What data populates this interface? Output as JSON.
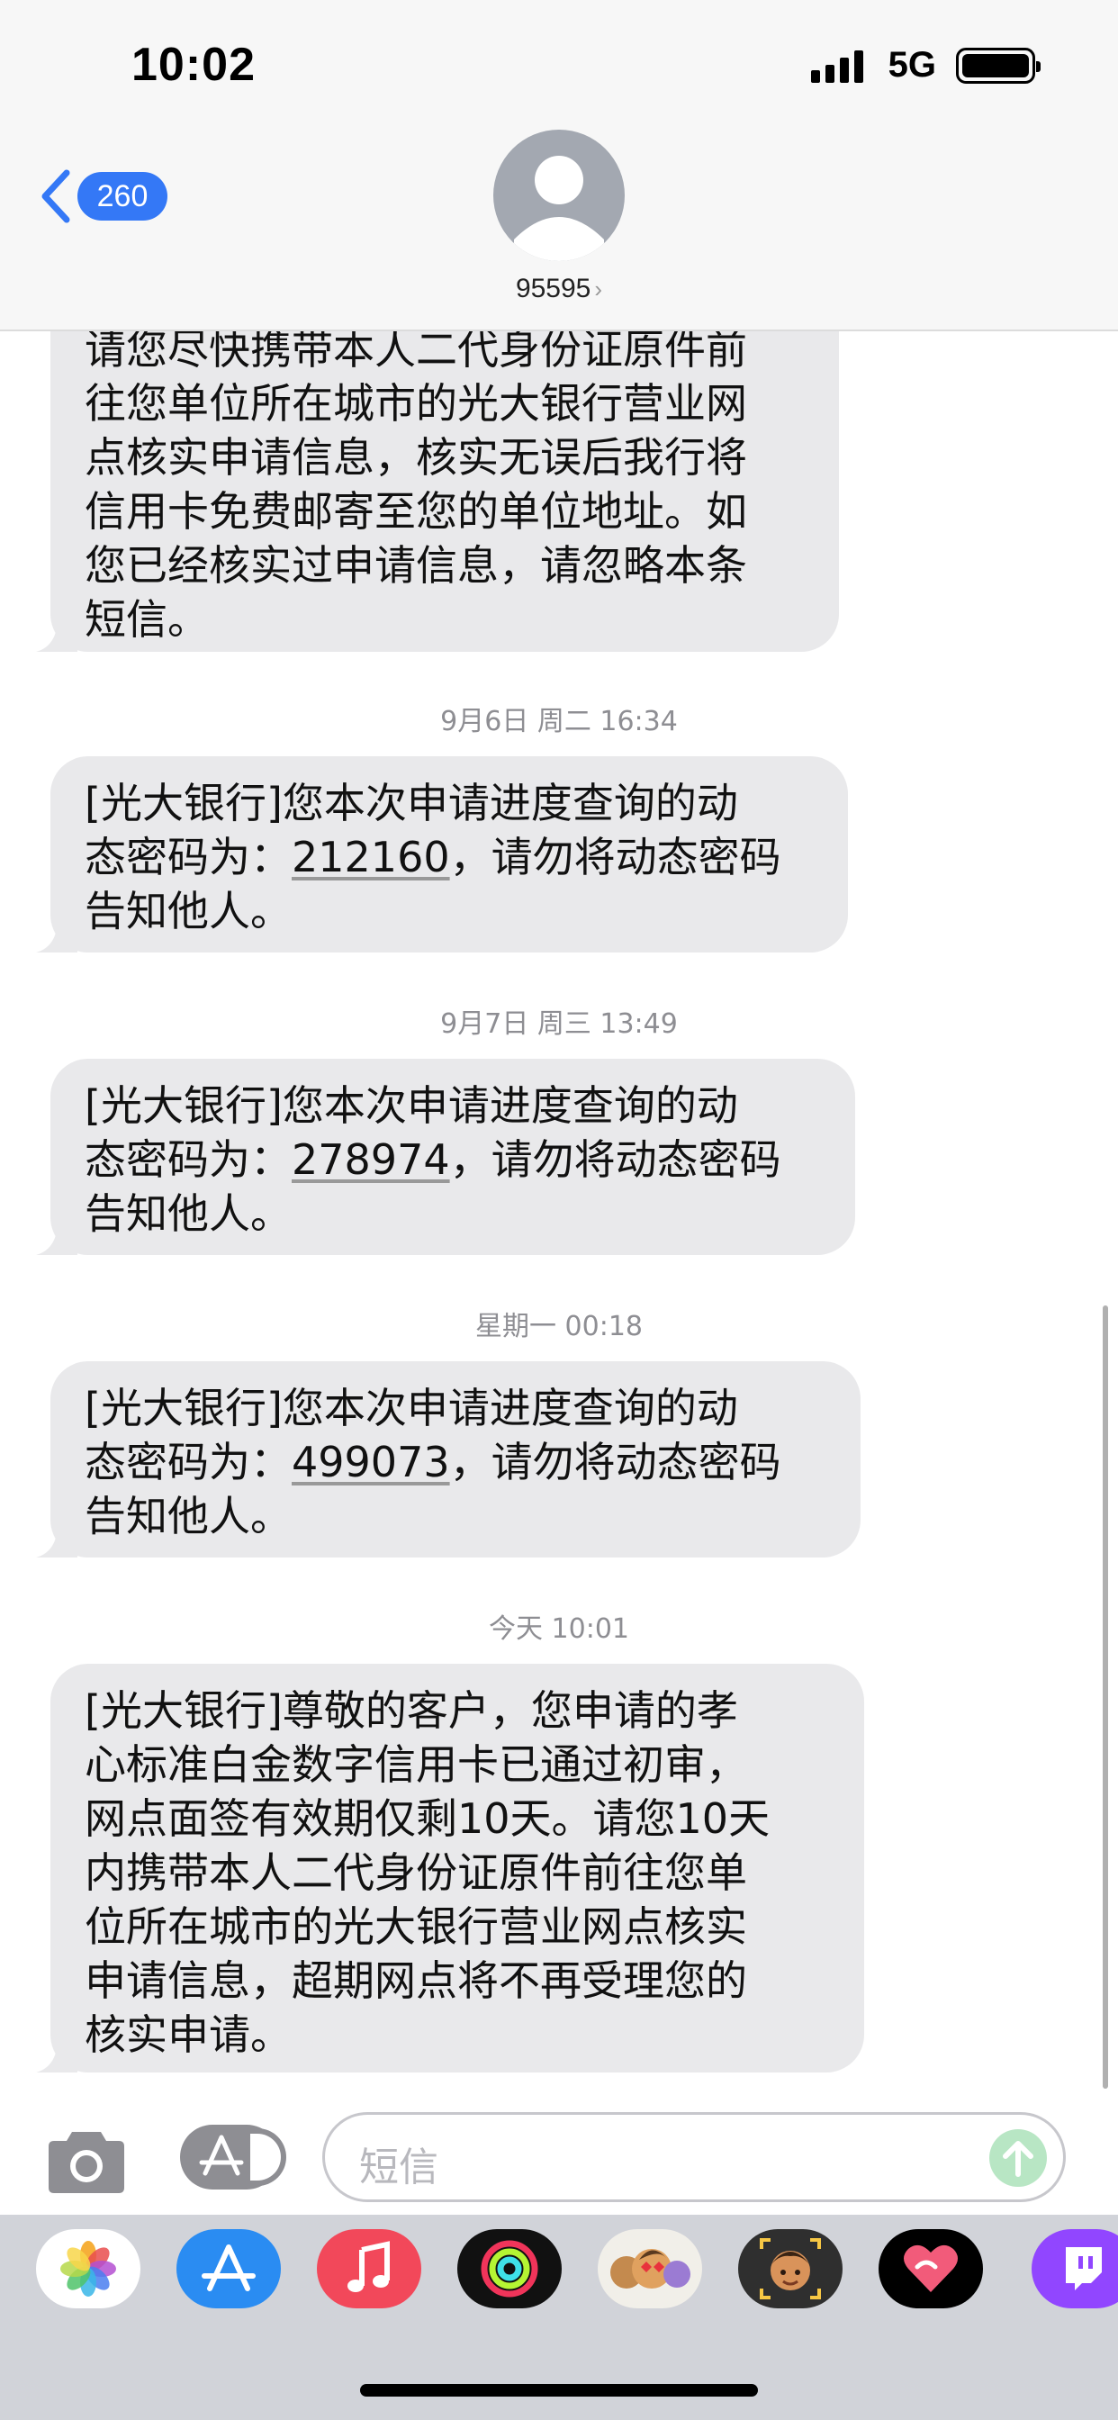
{
  "status_bar": {
    "time": "10:02",
    "network": "5G"
  },
  "nav": {
    "back_count": "260",
    "contact": "95595",
    "contact_chevron": "›"
  },
  "messages": {
    "m0": {
      "lines": [
        "请您尽快携带本人二代身份证原件前",
        "往您单位所在城市的光大银行营业网",
        "点核实申请信息，核实无误后我行将",
        "信用卡免费邮寄至您的单位地址。如",
        "您已经核实过申请信息，请忽略本条",
        "短信。"
      ]
    },
    "t1": "9月6日 周二 16:34",
    "m1": {
      "line1": "[光大银行]您本次申请进度查询的动",
      "prefix": "态密码为：",
      "code": "212160",
      "suffix": "，请勿将动态密码",
      "line3": "告知他人。"
    },
    "t2": "9月7日 周三 13:49",
    "m2": {
      "line1": "[光大银行]您本次申请进度查询的动",
      "prefix": "态密码为：",
      "code": "278974",
      "suffix": "，请勿将动态密码",
      "line3": "告知他人。"
    },
    "t3": "星期一 00:18",
    "m3": {
      "line1": "[光大银行]您本次申请进度查询的动",
      "prefix": "态密码为：",
      "code": "499073",
      "suffix": "，请勿将动态密码",
      "line3": "告知他人。"
    },
    "t4": "今天 10:01",
    "m4": {
      "lines": [
        "[光大银行]尊敬的客户，您申请的孝",
        "心标准白金数字信用卡已通过初审，",
        "网点面签有效期仅剩10天。请您10天",
        "内携带本人二代身份证原件前往您单",
        "位所在城市的光大银行营业网点核实",
        "申请信息，超期网点将不再受理您的",
        "核实申请。"
      ]
    }
  },
  "input": {
    "placeholder": "短信"
  },
  "icons": {
    "camera": "camera-icon",
    "apps": "app-store-icon",
    "send": "arrow-up-icon",
    "drawer": [
      "photos-icon",
      "app-store-icon",
      "music-icon",
      "activity-icon",
      "memoji-stickers-icon",
      "memoji-icon",
      "digital-touch-icon",
      "twitch-icon"
    ]
  },
  "colors": {
    "accent": "#3478f6",
    "bubble": "#e9e9eb",
    "timestamp": "#8e8e93",
    "send_disabled": "#b8e6c4"
  }
}
